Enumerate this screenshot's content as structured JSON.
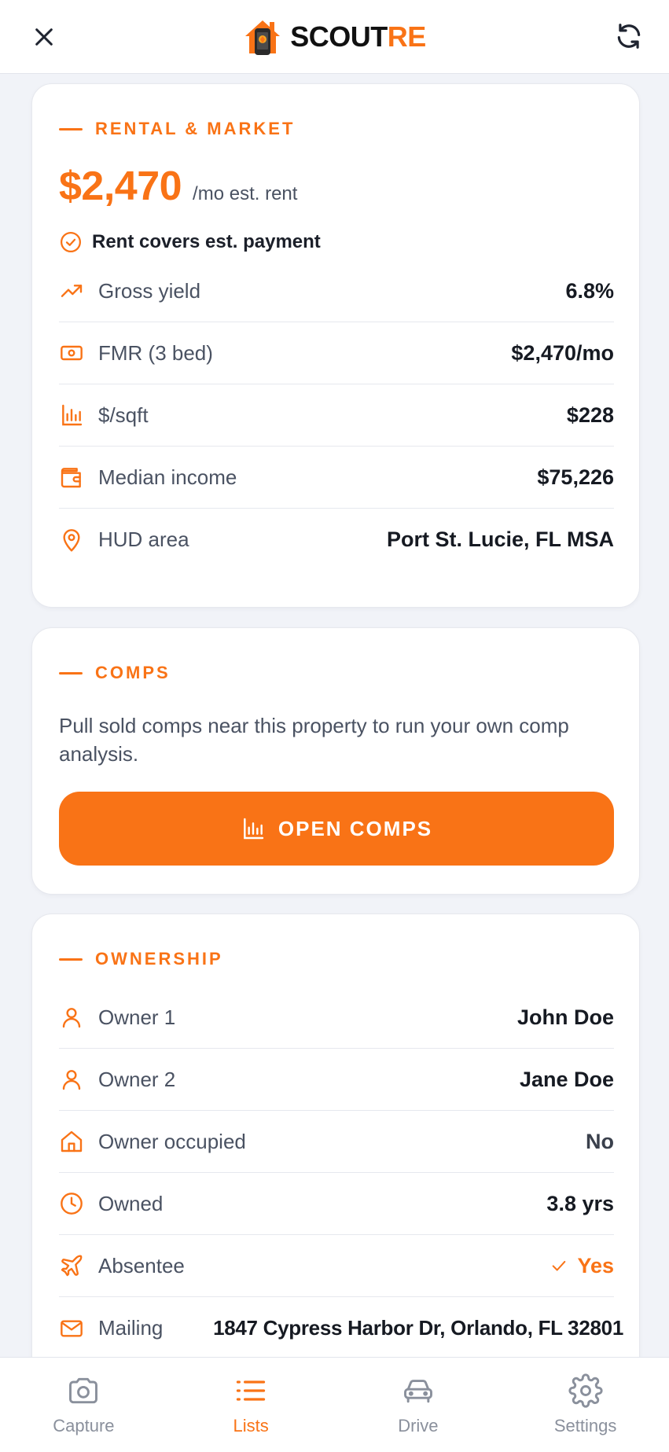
{
  "header": {
    "logo_text_main": "SCOUT",
    "logo_text_accent": "RE",
    "close_icon": "close-icon",
    "refresh_icon": "refresh-icon"
  },
  "rental": {
    "title": "RENTAL & MARKET",
    "rent_amount": "$2,470",
    "rent_unit": "/mo est. rent",
    "rent_covers": "Rent covers est. payment",
    "rows": [
      {
        "icon": "trending-up-icon",
        "label": "Gross yield",
        "value": "6.8%"
      },
      {
        "icon": "banknote-icon",
        "label": "FMR (3 bed)",
        "value": "$2,470/mo"
      },
      {
        "icon": "bar-chart-icon",
        "label": "$/sqft",
        "value": "$228"
      },
      {
        "icon": "wallet-icon",
        "label": "Median income",
        "value": "$75,226"
      },
      {
        "icon": "map-pin-icon",
        "label": "HUD area",
        "value": "Port St. Lucie, FL MSA"
      }
    ]
  },
  "comps": {
    "title": "COMPS",
    "description": "Pull sold comps near this property to run your own comp analysis.",
    "button_label": "OPEN COMPS"
  },
  "ownership": {
    "title": "OWNERSHIP",
    "rows": [
      {
        "icon": "user-icon",
        "label": "Owner 1",
        "value": "John Doe"
      },
      {
        "icon": "user-icon",
        "label": "Owner 2",
        "value": "Jane Doe"
      },
      {
        "icon": "home-icon",
        "label": "Owner occupied",
        "value": "No"
      },
      {
        "icon": "clock-icon",
        "label": "Owned",
        "value": "3.8 yrs"
      },
      {
        "icon": "plane-icon",
        "label": "Absentee",
        "value": "Yes"
      },
      {
        "icon": "mail-icon",
        "label": "Mailing",
        "value": "1847 Cypress Harbor Dr, Orlando, FL 32801"
      }
    ]
  },
  "nav": {
    "items": [
      {
        "label": "Capture",
        "icon": "camera-icon"
      },
      {
        "label": "Lists",
        "icon": "list-icon"
      },
      {
        "label": "Drive",
        "icon": "car-icon"
      },
      {
        "label": "Settings",
        "icon": "gear-icon"
      }
    ],
    "active": "Lists"
  },
  "colors": {
    "accent": "#f97316",
    "background": "#f1f3f8",
    "card": "#ffffff",
    "text_primary": "#161a22",
    "text_secondary": "#4a5262",
    "nav_inactive": "#8a909c"
  }
}
